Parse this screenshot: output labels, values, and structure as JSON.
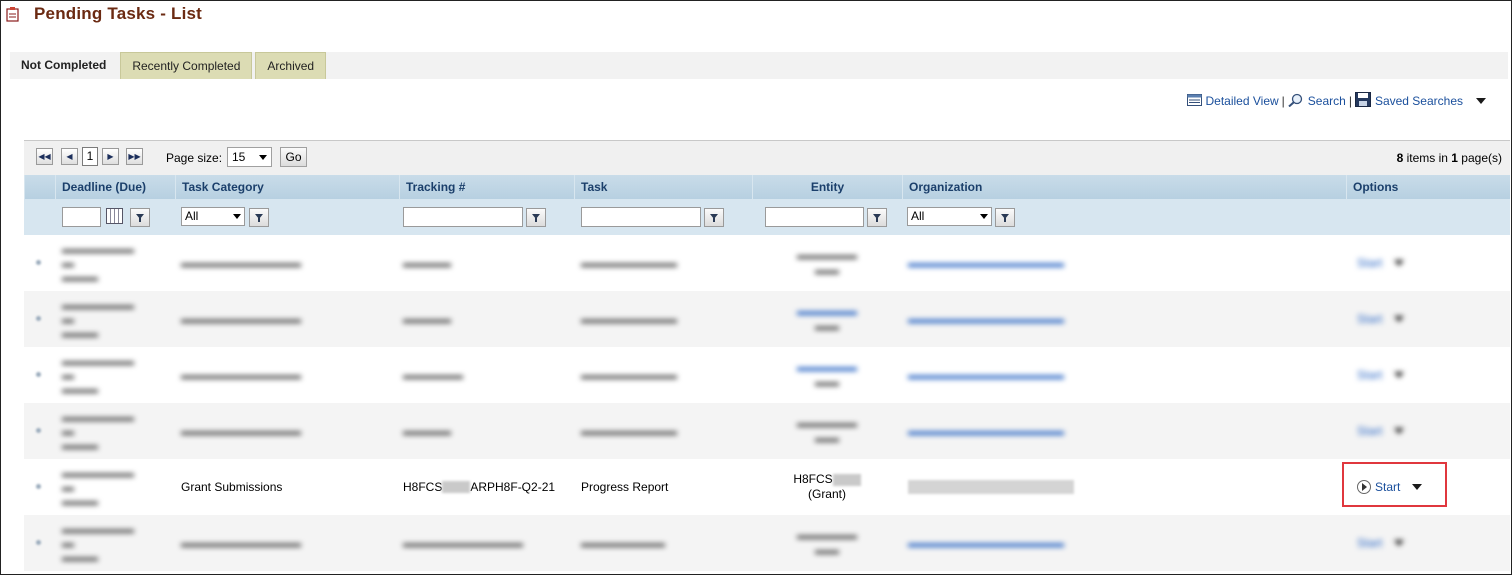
{
  "page": {
    "title": "Pending Tasks - List"
  },
  "tabs": [
    {
      "label": "Not Completed",
      "active": true
    },
    {
      "label": "Recently Completed",
      "active": false
    },
    {
      "label": "Archived",
      "active": false
    }
  ],
  "toolbar": {
    "detailed_view": "Detailed View",
    "search": "Search",
    "saved_searches": "Saved Searches"
  },
  "pager": {
    "current_page": "1",
    "page_size_label": "Page size:",
    "page_size": "15",
    "go_label": "Go",
    "items_count": "8",
    "items_text": " items in ",
    "page_count": "1",
    "pages_text": " page(s)"
  },
  "columns": {
    "deadline": "Deadline (Due)",
    "category": "Task Category",
    "tracking": "Tracking #",
    "task": "Task",
    "entity": "Entity",
    "organization": "Organization",
    "options": "Options"
  },
  "filters": {
    "category_value": "All",
    "organization_value": "All"
  },
  "rows": [
    {
      "deadline": "",
      "category": "",
      "tracking": "",
      "task": "",
      "entity_line1": "",
      "entity_line2": "",
      "organization": "",
      "option": "Start",
      "blurred": true
    },
    {
      "deadline": "",
      "category": "",
      "tracking": "",
      "task": "",
      "entity_line1": "",
      "entity_line2": "",
      "organization": "",
      "option": "Start",
      "blurred": true
    },
    {
      "deadline": "",
      "category": "",
      "tracking": "",
      "task": "",
      "entity_line1": "",
      "entity_line2": "",
      "organization": "",
      "option": "Start",
      "blurred": true
    },
    {
      "deadline": "",
      "category": "",
      "tracking": "",
      "task": "",
      "entity_line1": "",
      "entity_line2": "",
      "organization": "",
      "option": "Start",
      "blurred": true
    },
    {
      "deadline": "",
      "category": "Grant Submissions",
      "tracking_prefix": "H8FCS",
      "tracking_suffix": "ARPH8F-Q2-21",
      "task": "Progress Report",
      "entity_line1": "H8FCS",
      "entity_line2": "(Grant)",
      "organization": "",
      "option": "Start",
      "blurred": false
    },
    {
      "deadline": "",
      "category": "",
      "tracking": "",
      "task": "",
      "entity_line1": "",
      "entity_line2": "",
      "organization": "",
      "option": "Start",
      "blurred": true
    }
  ],
  "colors": {
    "title": "#6b2a12",
    "link": "#1a4f9c",
    "highlight": "#e0373e",
    "header_bg": "#c9dce9",
    "tab_inactive": "#dcdcb4"
  }
}
